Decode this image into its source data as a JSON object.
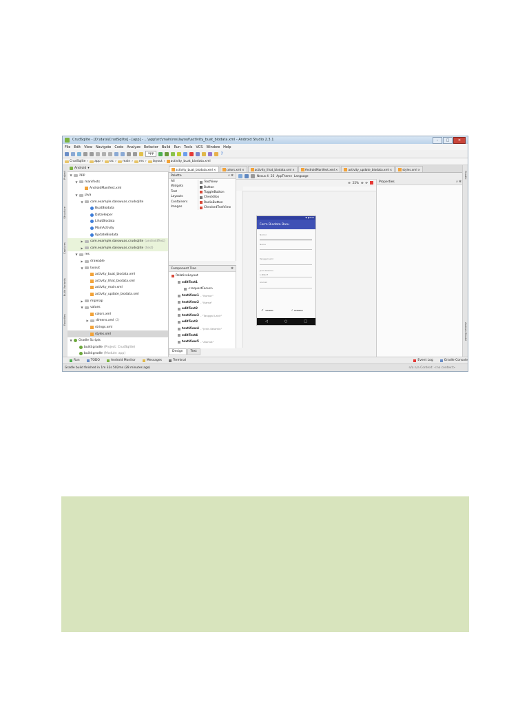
{
  "window": {
    "title": "CrudSqlite - [D:\\data\\CrudSqlite] - [app] - ...\\app\\src\\main\\res\\layout\\activity_buat_biodata.xml - Android Studio 2.3.1"
  },
  "menu": [
    "File",
    "Edit",
    "View",
    "Navigate",
    "Code",
    "Analyze",
    "Refactor",
    "Build",
    "Run",
    "Tools",
    "VCS",
    "Window",
    "Help"
  ],
  "toolbar": {
    "run_config": "app"
  },
  "breadcrumb": [
    "CrudSqlite",
    "app",
    "src",
    "main",
    "res",
    "layout",
    "activity_buat_biodata.xml"
  ],
  "project": {
    "view_label": "Android",
    "tree": [
      {
        "label": "app",
        "indent": 0,
        "type": "folder",
        "tw": "▼"
      },
      {
        "label": "manifests",
        "indent": 1,
        "type": "folder",
        "tw": "▼"
      },
      {
        "label": "AndroidManifest.xml",
        "indent": 2,
        "type": "xml",
        "tw": ""
      },
      {
        "label": "java",
        "indent": 1,
        "type": "folder",
        "tw": "▼"
      },
      {
        "label": "com.example.darowuas.crudsqlite",
        "indent": 2,
        "type": "folder",
        "tw": "▼"
      },
      {
        "label": "BuatBiodata",
        "indent": 3,
        "type": "class",
        "tw": ""
      },
      {
        "label": "DataHelper",
        "indent": 3,
        "type": "class",
        "tw": ""
      },
      {
        "label": "LihatBiodata",
        "indent": 3,
        "type": "class",
        "tw": ""
      },
      {
        "label": "MainActivity",
        "indent": 3,
        "type": "class",
        "tw": ""
      },
      {
        "label": "UpdateBiodata",
        "indent": 3,
        "type": "class",
        "tw": ""
      },
      {
        "label": "com.example.darowuas.crudsqlite",
        "indent": 2,
        "type": "folder",
        "tw": "▶",
        "hint": "(androidTest)",
        "hl": true
      },
      {
        "label": "com.example.darowuas.crudsqlite",
        "indent": 2,
        "type": "folder",
        "tw": "▶",
        "hint": "(test)",
        "hl": true
      },
      {
        "label": "res",
        "indent": 1,
        "type": "folder",
        "tw": "▼"
      },
      {
        "label": "drawable",
        "indent": 2,
        "type": "folder",
        "tw": "▶"
      },
      {
        "label": "layout",
        "indent": 2,
        "type": "folder",
        "tw": "▼"
      },
      {
        "label": "activity_buat_biodata.xml",
        "indent": 3,
        "type": "xml",
        "tw": ""
      },
      {
        "label": "activity_lihat_biodata.xml",
        "indent": 3,
        "type": "xml",
        "tw": ""
      },
      {
        "label": "activity_main.xml",
        "indent": 3,
        "type": "xml",
        "tw": ""
      },
      {
        "label": "activity_update_biodata.xml",
        "indent": 3,
        "type": "xml",
        "tw": ""
      },
      {
        "label": "mipmap",
        "indent": 2,
        "type": "folder",
        "tw": "▶"
      },
      {
        "label": "values",
        "indent": 2,
        "type": "folder",
        "tw": "▼"
      },
      {
        "label": "colors.xml",
        "indent": 3,
        "type": "xml",
        "tw": ""
      },
      {
        "label": "dimens.xml",
        "indent": 3,
        "type": "folder",
        "tw": "▶",
        "hint": "(2)"
      },
      {
        "label": "strings.xml",
        "indent": 3,
        "type": "xml",
        "tw": ""
      },
      {
        "label": "styles.xml",
        "indent": 3,
        "type": "xml",
        "tw": "",
        "sel": true
      },
      {
        "label": "Gradle Scripts",
        "indent": 0,
        "type": "gradle",
        "tw": "▼"
      },
      {
        "label": "build.gradle",
        "indent": 1,
        "type": "gradle",
        "tw": "",
        "hint": "(Project: CrudSqlite)"
      },
      {
        "label": "build.gradle",
        "indent": 1,
        "type": "gradle",
        "tw": "",
        "hint": "(Module: app)"
      },
      {
        "label": "gradle-wrapper.properties",
        "indent": 1,
        "type": "gradle",
        "tw": "",
        "hint": "(Gradle Version)"
      }
    ]
  },
  "editor_tabs": [
    {
      "label": "activity_buat_biodata.xml",
      "active": true
    },
    {
      "label": "colors.xml"
    },
    {
      "label": "activity_lihat_biodata.xml"
    },
    {
      "label": "AndroidManifest.xml"
    },
    {
      "label": "activity_update_biodata.xml"
    },
    {
      "label": "styles.xml"
    }
  ],
  "palette": {
    "title": "Palette",
    "categories": [
      "All",
      "Widgets",
      "Text",
      "Layouts",
      "Containers",
      "Images"
    ],
    "items": [
      {
        "label": "TextView",
        "color": "#888888"
      },
      {
        "label": "Button",
        "color": "#555555"
      },
      {
        "label": "ToggleButton",
        "color": "#d84a3a"
      },
      {
        "label": "CheckBox",
        "color": "#777777"
      },
      {
        "label": "RadioButton",
        "color": "#d84a3a"
      },
      {
        "label": "CheckedTextView",
        "color": "#d84a3a"
      }
    ]
  },
  "component_tree": {
    "title": "Component Tree",
    "rows": [
      {
        "label": "RelativeLayout",
        "indent": 0,
        "bold": false,
        "attr": ""
      },
      {
        "label": "editText1",
        "indent": 1,
        "bold": true,
        "attr": ""
      },
      {
        "label": "<requestFocus>",
        "indent": 2,
        "bold": false,
        "attr": ""
      },
      {
        "label": "textView1",
        "indent": 1,
        "bold": true,
        "attr": "- \"Nomor\""
      },
      {
        "label": "textView2",
        "indent": 1,
        "bold": true,
        "attr": "- \"Nama\""
      },
      {
        "label": "editText2",
        "indent": 1,
        "bold": true,
        "attr": ""
      },
      {
        "label": "textView3",
        "indent": 1,
        "bold": true,
        "attr": "- \"Tanggal Lahir\""
      },
      {
        "label": "editText3",
        "indent": 1,
        "bold": true,
        "attr": ""
      },
      {
        "label": "textView4",
        "indent": 1,
        "bold": true,
        "attr": "- \"Jenis Kelamin\""
      },
      {
        "label": "editText4",
        "indent": 1,
        "bold": true,
        "attr": ""
      },
      {
        "label": "textView5",
        "indent": 1,
        "bold": true,
        "attr": "- \"Alamat\""
      }
    ]
  },
  "design_tabs": [
    "Design",
    "Text"
  ],
  "canvas_bar": {
    "device": "Nexus 4",
    "api": "25",
    "theme": "AppTheme",
    "lang": "Language",
    "zoom": "25%"
  },
  "phone": {
    "status_text": "▼ ▮ 8:00",
    "appbar_title": "Form Biodata Baru",
    "fields": [
      "Nomor",
      "Nama",
      "Tanggal Lahir",
      "Jenis Kelamin",
      "Alamat"
    ],
    "gender_value": "L atau P",
    "save_label": "SIMPAN",
    "back_label": "KEMBALI",
    "nav": [
      "◁",
      "○",
      "□"
    ]
  },
  "properties": {
    "title": "Properties"
  },
  "bottom_tools": [
    "Run",
    "TODO",
    "Android Monitor",
    "Messages",
    "Terminal",
    "Event Log",
    "Gradle Console"
  ],
  "status_bar": {
    "message": "Gradle build finished in 1m 32s 502ms (28 minutes ago)",
    "right": "n/a   n/a   Context: <no context>"
  },
  "side_labels": {
    "left": [
      "Project",
      "Structure",
      "Captures",
      "Build Variants",
      "Favorites"
    ],
    "right": [
      "Gradle",
      "Android Model"
    ]
  },
  "colors": {
    "accent": "#3f51b5",
    "status": "#303f9f",
    "green_box": "#d8e4bd"
  }
}
